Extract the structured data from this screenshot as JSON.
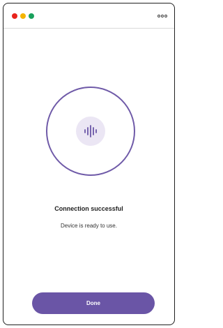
{
  "window": {
    "traffic_lights": {
      "close_color": "#e8231c",
      "minimize_color": "#f4b400",
      "maximize_color": "#19a15c"
    },
    "more_icon": "more-horizontal-icon"
  },
  "status": {
    "icon": "audio-waveform-icon",
    "accent_color": "#6a55a6",
    "title": "Connection successful",
    "message": "Device is ready to use."
  },
  "actions": {
    "done_label": "Done"
  }
}
